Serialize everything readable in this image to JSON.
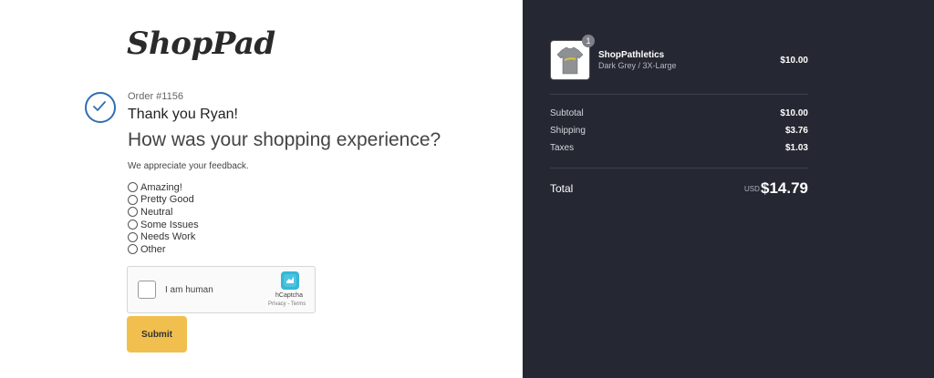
{
  "brand": {
    "logo_text": "ShopPad"
  },
  "confirmation": {
    "order": "Order #1156",
    "thank_you": "Thank you Ryan!",
    "question": "How was your shopping experience?",
    "appreciate": "We appreciate your feedback."
  },
  "feedback": {
    "options": [
      "Amazing!",
      "Pretty Good",
      "Neutral",
      "Some Issues",
      "Needs Work",
      "Other"
    ],
    "selected": null
  },
  "captcha": {
    "label": "I am human",
    "provider": "hCaptcha",
    "links": "Privacy - Terms"
  },
  "actions": {
    "submit_label": "Submit"
  },
  "cart": {
    "quantity": "1",
    "product_name": "ShopPathletics",
    "variant": "Dark Grey / 3X-Large",
    "price": "$10.00"
  },
  "summary": {
    "subtotal_label": "Subtotal",
    "subtotal": "$10.00",
    "shipping_label": "Shipping",
    "shipping": "$3.76",
    "taxes_label": "Taxes",
    "taxes": "$1.03",
    "total_label": "Total",
    "currency": "USD",
    "total": "$14.79"
  },
  "colors": {
    "sidebar_bg": "#252832",
    "accent_blue": "#2f6fb2",
    "submit_bg": "#f1bf4d"
  }
}
